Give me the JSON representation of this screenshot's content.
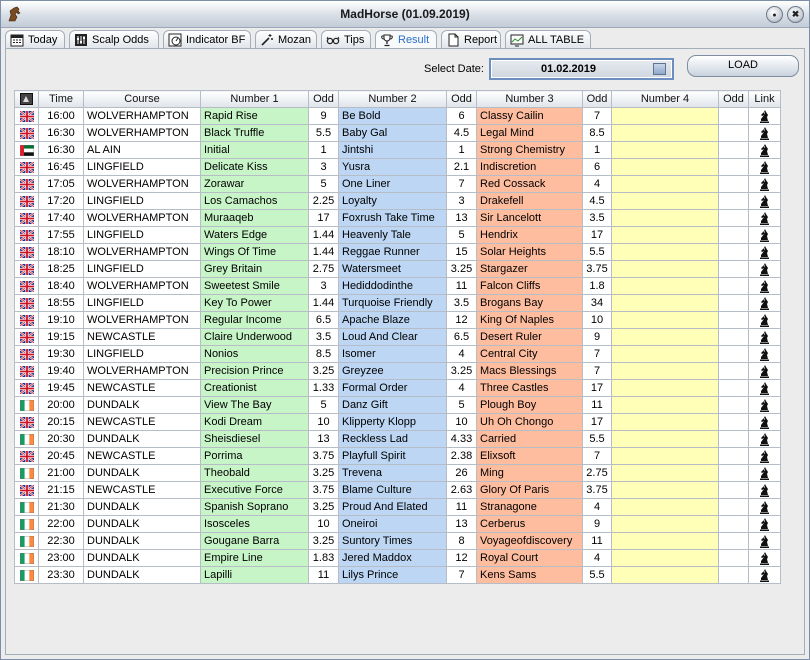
{
  "window": {
    "title": "MadHorse (01.09.2019)",
    "minimize": "●",
    "close": "✖"
  },
  "tabs": [
    {
      "label": "Today",
      "icon": "calendar-icon"
    },
    {
      "label": "Scalp Odds",
      "icon": "sliders-icon"
    },
    {
      "label": "Indicator BF",
      "icon": "gauge-icon"
    },
    {
      "label": "Mozan",
      "icon": "wand-icon"
    },
    {
      "label": "Tips",
      "icon": "glasses-icon"
    },
    {
      "label": "Result",
      "icon": "trophy-icon",
      "active": true
    },
    {
      "label": "Report",
      "icon": "document-icon"
    },
    {
      "label": "ALL TABLE",
      "icon": "chart-icon"
    }
  ],
  "toolbar": {
    "select_date_label": "Select Date:",
    "date_value": "01.02.2019",
    "load_label": "LOAD"
  },
  "table": {
    "headers": [
      "",
      "Time",
      "Course",
      "Number 1",
      "Odd",
      "Number 2",
      "Odd",
      "Number 3",
      "Odd",
      "Number 4",
      "Odd",
      "Link"
    ],
    "colors": {
      "n1": "#c8f5c8",
      "n2": "#bcd6f3",
      "n3": "#ffbda0",
      "n4": "#ffffb8"
    },
    "rows": [
      {
        "flag": "gb",
        "time": "16:00",
        "course": "WOLVERHAMPTON",
        "n1": "Rapid Rise",
        "o1": "9",
        "n2": "Be Bold",
        "o2": "6",
        "n3": "Classy Cailin",
        "o3": "7",
        "n4": "",
        "o4": ""
      },
      {
        "flag": "gb",
        "time": "16:30",
        "course": "WOLVERHAMPTON",
        "n1": "Black Truffle",
        "o1": "5.5",
        "n2": "Baby Gal",
        "o2": "4.5",
        "n3": "Legal Mind",
        "o3": "8.5",
        "n4": "",
        "o4": ""
      },
      {
        "flag": "ae",
        "time": "16:30",
        "course": "AL AIN",
        "n1": "Initial",
        "o1": "1",
        "n2": "Jintshi",
        "o2": "1",
        "n3": "Strong Chemistry",
        "o3": "1",
        "n4": "",
        "o4": ""
      },
      {
        "flag": "gb",
        "time": "16:45",
        "course": "LINGFIELD",
        "n1": "Delicate Kiss",
        "o1": "3",
        "n2": "Yusra",
        "o2": "2.1",
        "n3": "Indiscretion",
        "o3": "6",
        "n4": "",
        "o4": ""
      },
      {
        "flag": "gb",
        "time": "17:05",
        "course": "WOLVERHAMPTON",
        "n1": "Zorawar",
        "o1": "5",
        "n2": "One Liner",
        "o2": "7",
        "n3": "Red Cossack",
        "o3": "4",
        "n4": "",
        "o4": ""
      },
      {
        "flag": "gb",
        "time": "17:20",
        "course": "LINGFIELD",
        "n1": "Los Camachos",
        "o1": "2.25",
        "n2": "Loyalty",
        "o2": "3",
        "n3": "Drakefell",
        "o3": "4.5",
        "n4": "",
        "o4": ""
      },
      {
        "flag": "gb",
        "time": "17:40",
        "course": "WOLVERHAMPTON",
        "n1": "Muraaqeb",
        "o1": "17",
        "n2": "Foxrush Take Time",
        "o2": "13",
        "n3": "Sir Lancelott",
        "o3": "3.5",
        "n4": "",
        "o4": ""
      },
      {
        "flag": "gb",
        "time": "17:55",
        "course": "LINGFIELD",
        "n1": "Waters Edge",
        "o1": "1.44",
        "n2": "Heavenly Tale",
        "o2": "5",
        "n3": "Hendrix",
        "o3": "17",
        "n4": "",
        "o4": ""
      },
      {
        "flag": "gb",
        "time": "18:10",
        "course": "WOLVERHAMPTON",
        "n1": "Wings Of Time",
        "o1": "1.44",
        "n2": "Reggae Runner",
        "o2": "15",
        "n3": "Solar Heights",
        "o3": "5.5",
        "n4": "",
        "o4": ""
      },
      {
        "flag": "gb",
        "time": "18:25",
        "course": "LINGFIELD",
        "n1": "Grey Britain",
        "o1": "2.75",
        "n2": "Watersmeet",
        "o2": "3.25",
        "n3": "Stargazer",
        "o3": "3.75",
        "n4": "",
        "o4": ""
      },
      {
        "flag": "gb",
        "time": "18:40",
        "course": "WOLVERHAMPTON",
        "n1": "Sweetest Smile",
        "o1": "3",
        "n2": "Hediddodinthe",
        "o2": "11",
        "n3": "Falcon Cliffs",
        "o3": "1.8",
        "n4": "",
        "o4": ""
      },
      {
        "flag": "gb",
        "time": "18:55",
        "course": "LINGFIELD",
        "n1": "Key To Power",
        "o1": "1.44",
        "n2": "Turquoise Friendly",
        "o2": "3.5",
        "n3": "Brogans Bay",
        "o3": "34",
        "n4": "",
        "o4": ""
      },
      {
        "flag": "gb",
        "time": "19:10",
        "course": "WOLVERHAMPTON",
        "n1": "Regular Income",
        "o1": "6.5",
        "n2": "Apache Blaze",
        "o2": "12",
        "n3": "King Of Naples",
        "o3": "10",
        "n4": "",
        "o4": ""
      },
      {
        "flag": "gb",
        "time": "19:15",
        "course": "NEWCASTLE",
        "n1": "Claire Underwood",
        "o1": "3.5",
        "n2": "Loud And Clear",
        "o2": "6.5",
        "n3": "Desert Ruler",
        "o3": "9",
        "n4": "",
        "o4": ""
      },
      {
        "flag": "gb",
        "time": "19:30",
        "course": "LINGFIELD",
        "n1": "Nonios",
        "o1": "8.5",
        "n2": "Isomer",
        "o2": "4",
        "n3": "Central City",
        "o3": "7",
        "n4": "",
        "o4": ""
      },
      {
        "flag": "gb",
        "time": "19:40",
        "course": "WOLVERHAMPTON",
        "n1": "Precision Prince",
        "o1": "3.25",
        "n2": "Greyzee",
        "o2": "3.25",
        "n3": "Macs Blessings",
        "o3": "7",
        "n4": "",
        "o4": ""
      },
      {
        "flag": "gb",
        "time": "19:45",
        "course": "NEWCASTLE",
        "n1": "Creationist",
        "o1": "1.33",
        "n2": "Formal Order",
        "o2": "4",
        "n3": "Three Castles",
        "o3": "17",
        "n4": "",
        "o4": ""
      },
      {
        "flag": "ie",
        "time": "20:00",
        "course": "DUNDALK",
        "n1": "View The Bay",
        "o1": "5",
        "n2": "Danz Gift",
        "o2": "5",
        "n3": "Plough Boy",
        "o3": "11",
        "n4": "",
        "o4": ""
      },
      {
        "flag": "gb",
        "time": "20:15",
        "course": "NEWCASTLE",
        "n1": "Kodi Dream",
        "o1": "10",
        "n2": "Klipperty Klopp",
        "o2": "10",
        "n3": "Uh Oh Chongo",
        "o3": "17",
        "n4": "",
        "o4": ""
      },
      {
        "flag": "ie",
        "time": "20:30",
        "course": "DUNDALK",
        "n1": "Sheisdiesel",
        "o1": "13",
        "n2": "Reckless Lad",
        "o2": "4.33",
        "n3": "Carried",
        "o3": "5.5",
        "n4": "",
        "o4": ""
      },
      {
        "flag": "gb",
        "time": "20:45",
        "course": "NEWCASTLE",
        "n1": "Porrima",
        "o1": "3.75",
        "n2": "Playfull Spirit",
        "o2": "2.38",
        "n3": "Elixsoft",
        "o3": "7",
        "n4": "",
        "o4": ""
      },
      {
        "flag": "ie",
        "time": "21:00",
        "course": "DUNDALK",
        "n1": "Theobald",
        "o1": "3.25",
        "n2": "Trevena",
        "o2": "26",
        "n3": "Ming",
        "o3": "2.75",
        "n4": "",
        "o4": ""
      },
      {
        "flag": "gb",
        "time": "21:15",
        "course": "NEWCASTLE",
        "n1": "Executive Force",
        "o1": "3.75",
        "n2": "Blame Culture",
        "o2": "2.63",
        "n3": "Glory Of Paris",
        "o3": "3.75",
        "n4": "",
        "o4": ""
      },
      {
        "flag": "ie",
        "time": "21:30",
        "course": "DUNDALK",
        "n1": "Spanish Soprano",
        "o1": "3.25",
        "n2": "Proud And Elated",
        "o2": "11",
        "n3": "Stranagone",
        "o3": "4",
        "n4": "",
        "o4": ""
      },
      {
        "flag": "ie",
        "time": "22:00",
        "course": "DUNDALK",
        "n1": "Isosceles",
        "o1": "10",
        "n2": "Oneiroi",
        "o2": "13",
        "n3": "Cerberus",
        "o3": "9",
        "n4": "",
        "o4": ""
      },
      {
        "flag": "ie",
        "time": "22:30",
        "course": "DUNDALK",
        "n1": "Gougane Barra",
        "o1": "3.25",
        "n2": "Suntory Times",
        "o2": "8",
        "n3": "Voyageofdiscovery",
        "o3": "11",
        "n4": "",
        "o4": ""
      },
      {
        "flag": "ie",
        "time": "23:00",
        "course": "DUNDALK",
        "n1": "Empire Line",
        "o1": "1.83",
        "n2": "Jered Maddox",
        "o2": "12",
        "n3": "Royal Court",
        "o3": "4",
        "n4": "",
        "o4": ""
      },
      {
        "flag": "ie",
        "time": "23:30",
        "course": "DUNDALK",
        "n1": "Lapilli",
        "o1": "11",
        "n2": "Lilys Prince",
        "o2": "7",
        "n3": "Kens Sams",
        "o3": "5.5",
        "n4": "",
        "o4": ""
      }
    ]
  }
}
